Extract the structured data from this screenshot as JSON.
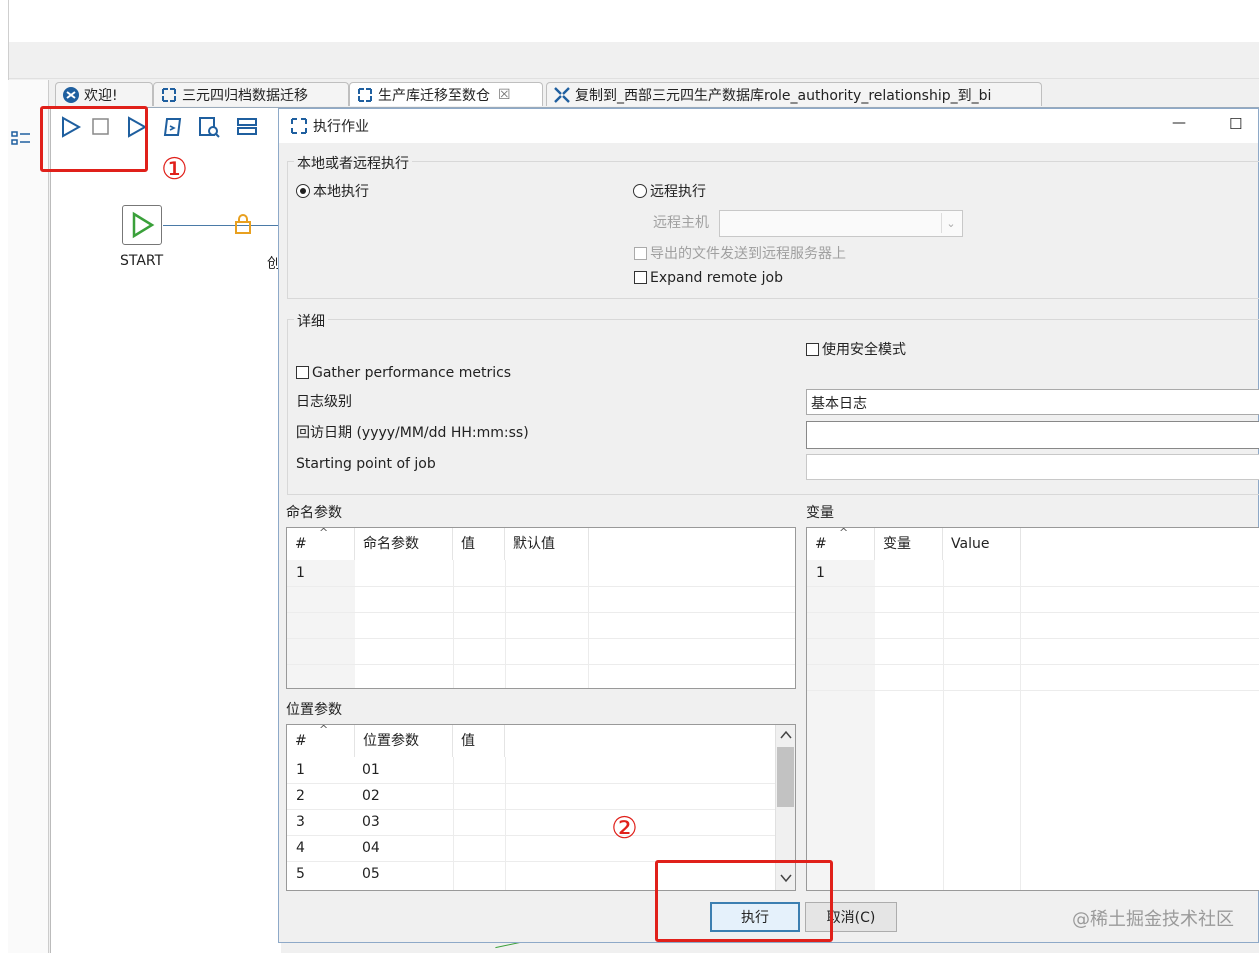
{
  "tabs": [
    {
      "label": "欢迎!",
      "icon": "welcome-icon"
    },
    {
      "label": "三元四归档数据迁移",
      "icon": "job-icon"
    },
    {
      "label": "生产库迁移至数仓",
      "icon": "job-icon",
      "close": "☒"
    },
    {
      "label": "复制到_西部三元四生产数据库role_authority_relationship_到_bi",
      "icon": "transform-icon"
    }
  ],
  "canvas": {
    "start_label": "START",
    "annotation_1": "①",
    "partial_label": "创"
  },
  "dialog": {
    "title": "执行作业",
    "minimize": "—",
    "maximize": "☐",
    "exec_group": {
      "label": "本地或者远程执行",
      "local": "本地执行",
      "local_selected": true,
      "remote": "远程执行",
      "remote_host_label": "远程主机",
      "remote_host_value": "",
      "send_files": "导出的文件发送到远程服务器上",
      "expand_remote": "Expand remote job"
    },
    "details": {
      "label": "详细",
      "safe_mode": "使用安全模式",
      "gather_metrics": "Gather performance metrics",
      "log_level_label": "日志级别",
      "log_level_value": "基本日志",
      "replay_date_label": "回访日期 (yyyy/MM/dd HH:mm:ss)",
      "replay_date_value": "",
      "start_point_label": "Starting point of job",
      "start_point_value": ""
    },
    "named_params": {
      "label": "命名参数",
      "columns": [
        "#",
        "命名参数",
        "值",
        "默认值"
      ],
      "rows": [
        [
          "1",
          "",
          "",
          ""
        ]
      ]
    },
    "variables": {
      "label": "变量",
      "columns": [
        "#",
        "变量",
        "Value"
      ],
      "rows": [
        [
          "1",
          "",
          ""
        ]
      ]
    },
    "positional_params": {
      "label": "位置参数",
      "columns": [
        "#",
        "位置参数",
        "值"
      ],
      "rows": [
        [
          "1",
          "01",
          ""
        ],
        [
          "2",
          "02",
          ""
        ],
        [
          "3",
          "03",
          ""
        ],
        [
          "4",
          "04",
          ""
        ],
        [
          "5",
          "05",
          ""
        ]
      ]
    },
    "annotation_2": "②",
    "run_button": "执行",
    "cancel_button": "取消(C)"
  },
  "watermark": "@稀土掘金技术社区",
  "colors": {
    "annotation_red": "#e0201a",
    "start_green": "#3aa03a",
    "tab_blue": "#1f5f9f"
  }
}
